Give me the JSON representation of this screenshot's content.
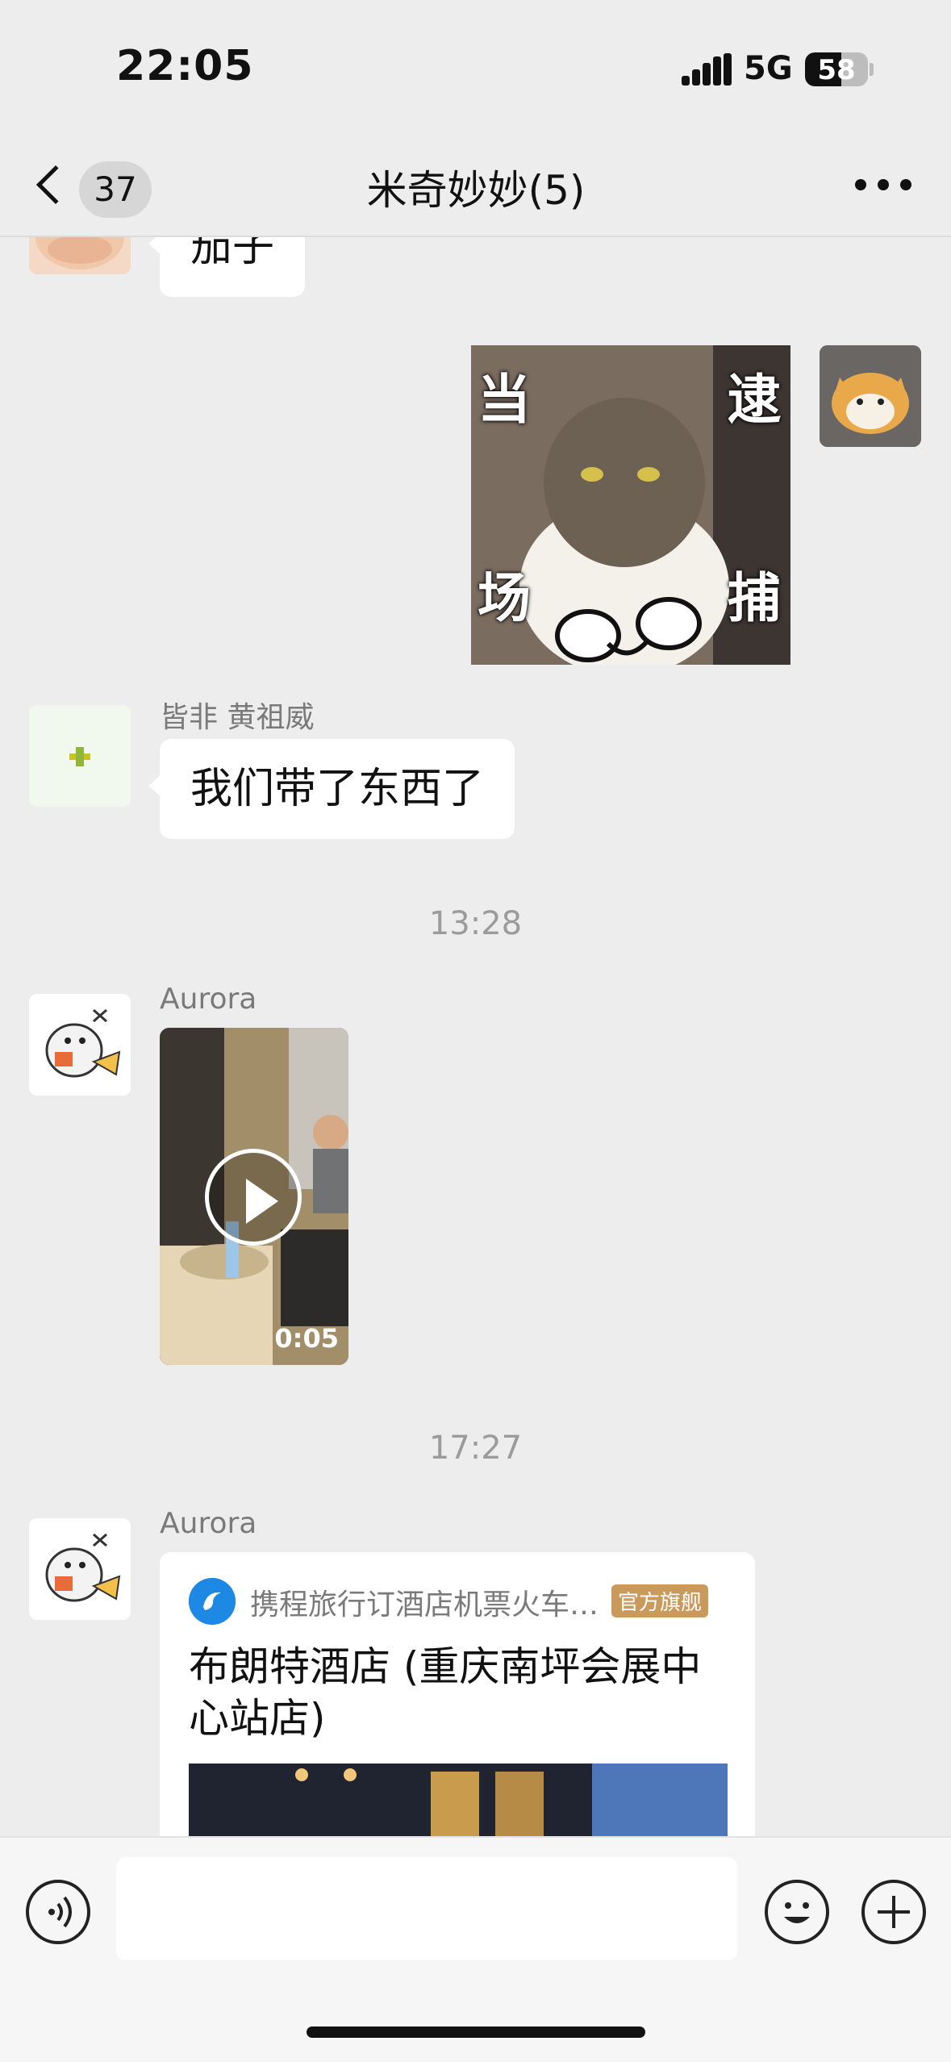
{
  "status_bar": {
    "time": "22:05",
    "network": "5G",
    "battery_level": "58",
    "battery_fraction": 0.58
  },
  "header": {
    "unread_count": "37",
    "title": "米奇妙妙(5)"
  },
  "messages": [
    {
      "type": "text",
      "direction": "incoming",
      "text": "茄子"
    },
    {
      "type": "sticker",
      "direction": "outgoing",
      "text_chars": [
        "当",
        "逮",
        "场",
        "捕"
      ]
    },
    {
      "type": "text",
      "direction": "incoming",
      "sender": "皆非 黄祖威",
      "text": "我们带了东西了"
    },
    {
      "type": "timestamp",
      "text": "13:28"
    },
    {
      "type": "video",
      "direction": "incoming",
      "sender": "Aurora",
      "duration": "0:05"
    },
    {
      "type": "timestamp",
      "text": "17:27"
    },
    {
      "type": "link_card",
      "direction": "incoming",
      "sender": "Aurora",
      "source": "携程旅行订酒店机票火车…",
      "badge": "官方旗舰",
      "title": "布朗特酒店 (重庆南坪会展中心站店)"
    }
  ],
  "colors": {
    "chat_background": "#ededed",
    "bubble": "#ffffff",
    "badge": "#c99a5b",
    "link_logo": "#1e88e5"
  },
  "icons": [
    "back-icon",
    "more-icon",
    "play-icon",
    "voice-icon",
    "emoji-icon",
    "plus-icon",
    "ctrip-logo-icon"
  ]
}
